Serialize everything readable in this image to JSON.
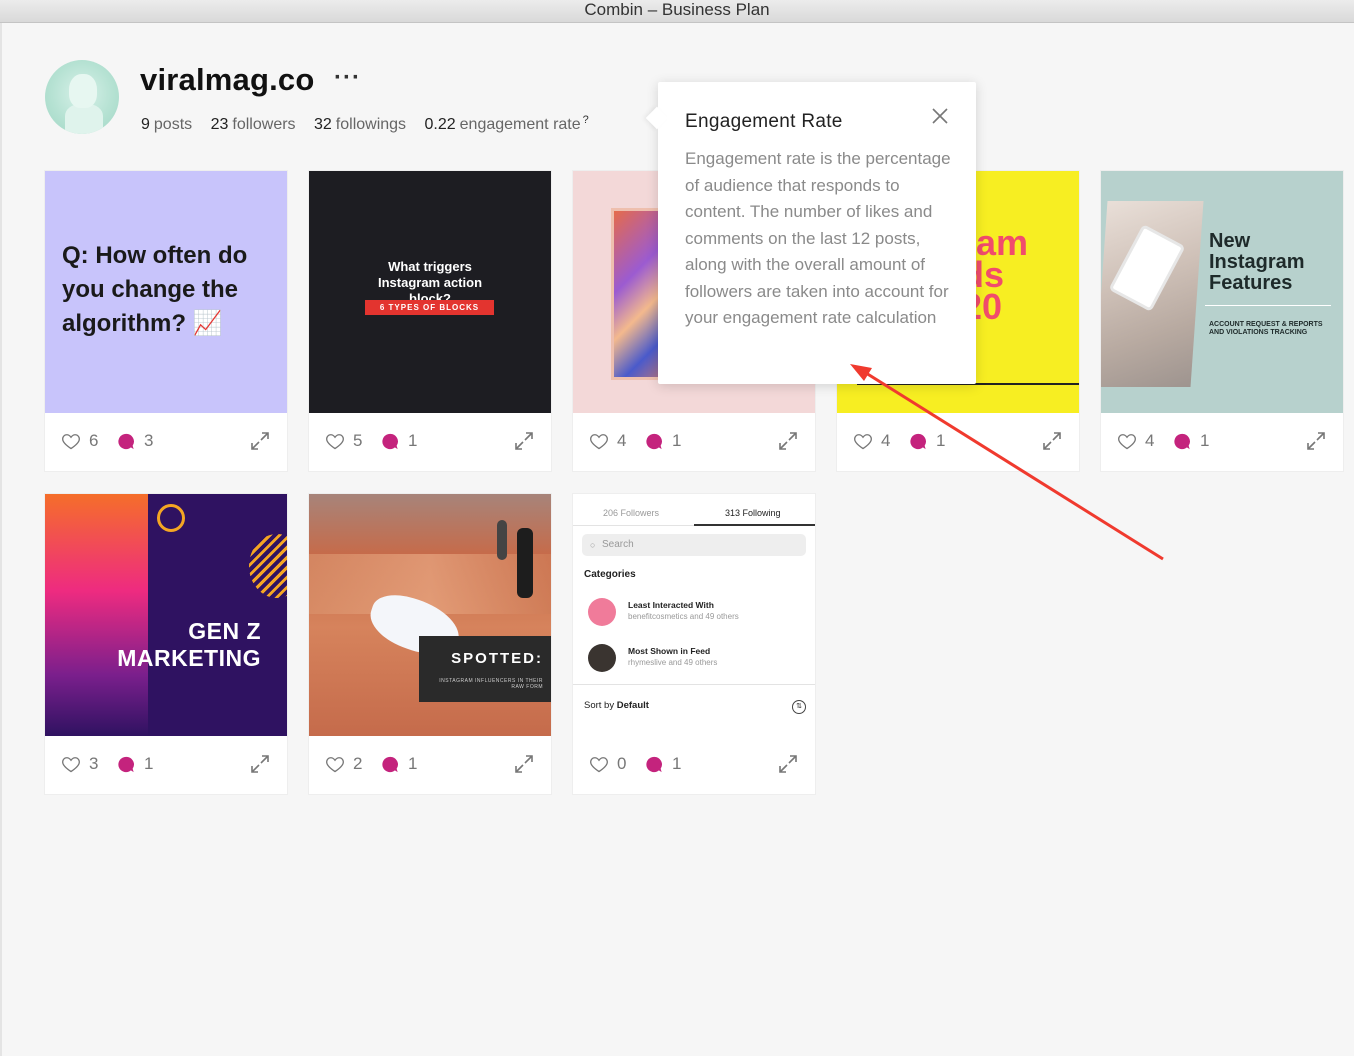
{
  "window": {
    "title": "Combin  – Business Plan"
  },
  "profile": {
    "username": "viralmag.co",
    "more": "···",
    "posts": "9",
    "posts_label": "posts",
    "followers": "23",
    "followers_label": "followers",
    "followings": "32",
    "followings_label": "followings",
    "engagement": "0.22",
    "engagement_label": "engagement rate",
    "help": "?"
  },
  "tooltip": {
    "title": "Engagement Rate",
    "body": "Engagement rate is the percentage of audience that responds to content. The number of likes and comments on the last 12 posts, along with the overall amount of followers are taken into account for your engagement rate calculation"
  },
  "posts": [
    {
      "likes": "6",
      "comments": "3",
      "text": "Q: How often do you change the algorithm? 📈"
    },
    {
      "likes": "5",
      "comments": "1",
      "text": "What triggers Instagram action block?",
      "tag": "6 TYPES OF BLOCKS"
    },
    {
      "likes": "4",
      "comments": "1"
    },
    {
      "likes": "4",
      "comments": "1",
      "text": "ram\nds\n20"
    },
    {
      "likes": "4",
      "comments": "1",
      "text": "New Instagram Features",
      "sub": "ACCOUNT REQUEST & REPORTS AND VIOLATIONS TRACKING"
    },
    {
      "likes": "3",
      "comments": "1",
      "text": "GEN Z\nMARKETING"
    },
    {
      "likes": "2",
      "comments": "1",
      "text": "SPOTTED:",
      "sub": "INSTAGRAM INFLUENCERS IN THEIR RAW FORM"
    },
    {
      "likes": "0",
      "comments": "1",
      "tab_followers": "206 Followers",
      "tab_following": "313 Following",
      "search": "Search",
      "categories": "Categories",
      "row1_title": "Least Interacted With",
      "row1_sub": "benefitcosmetics and 49 others",
      "row2_title": "Most Shown in Feed",
      "row2_sub": "rhymeslive and 49 others",
      "sort_prefix": "Sort by ",
      "sort_value": "Default"
    }
  ],
  "colors": {
    "comment": "#c4237d",
    "arrow": "#f03a2e",
    "background": "#f6f6f6"
  }
}
